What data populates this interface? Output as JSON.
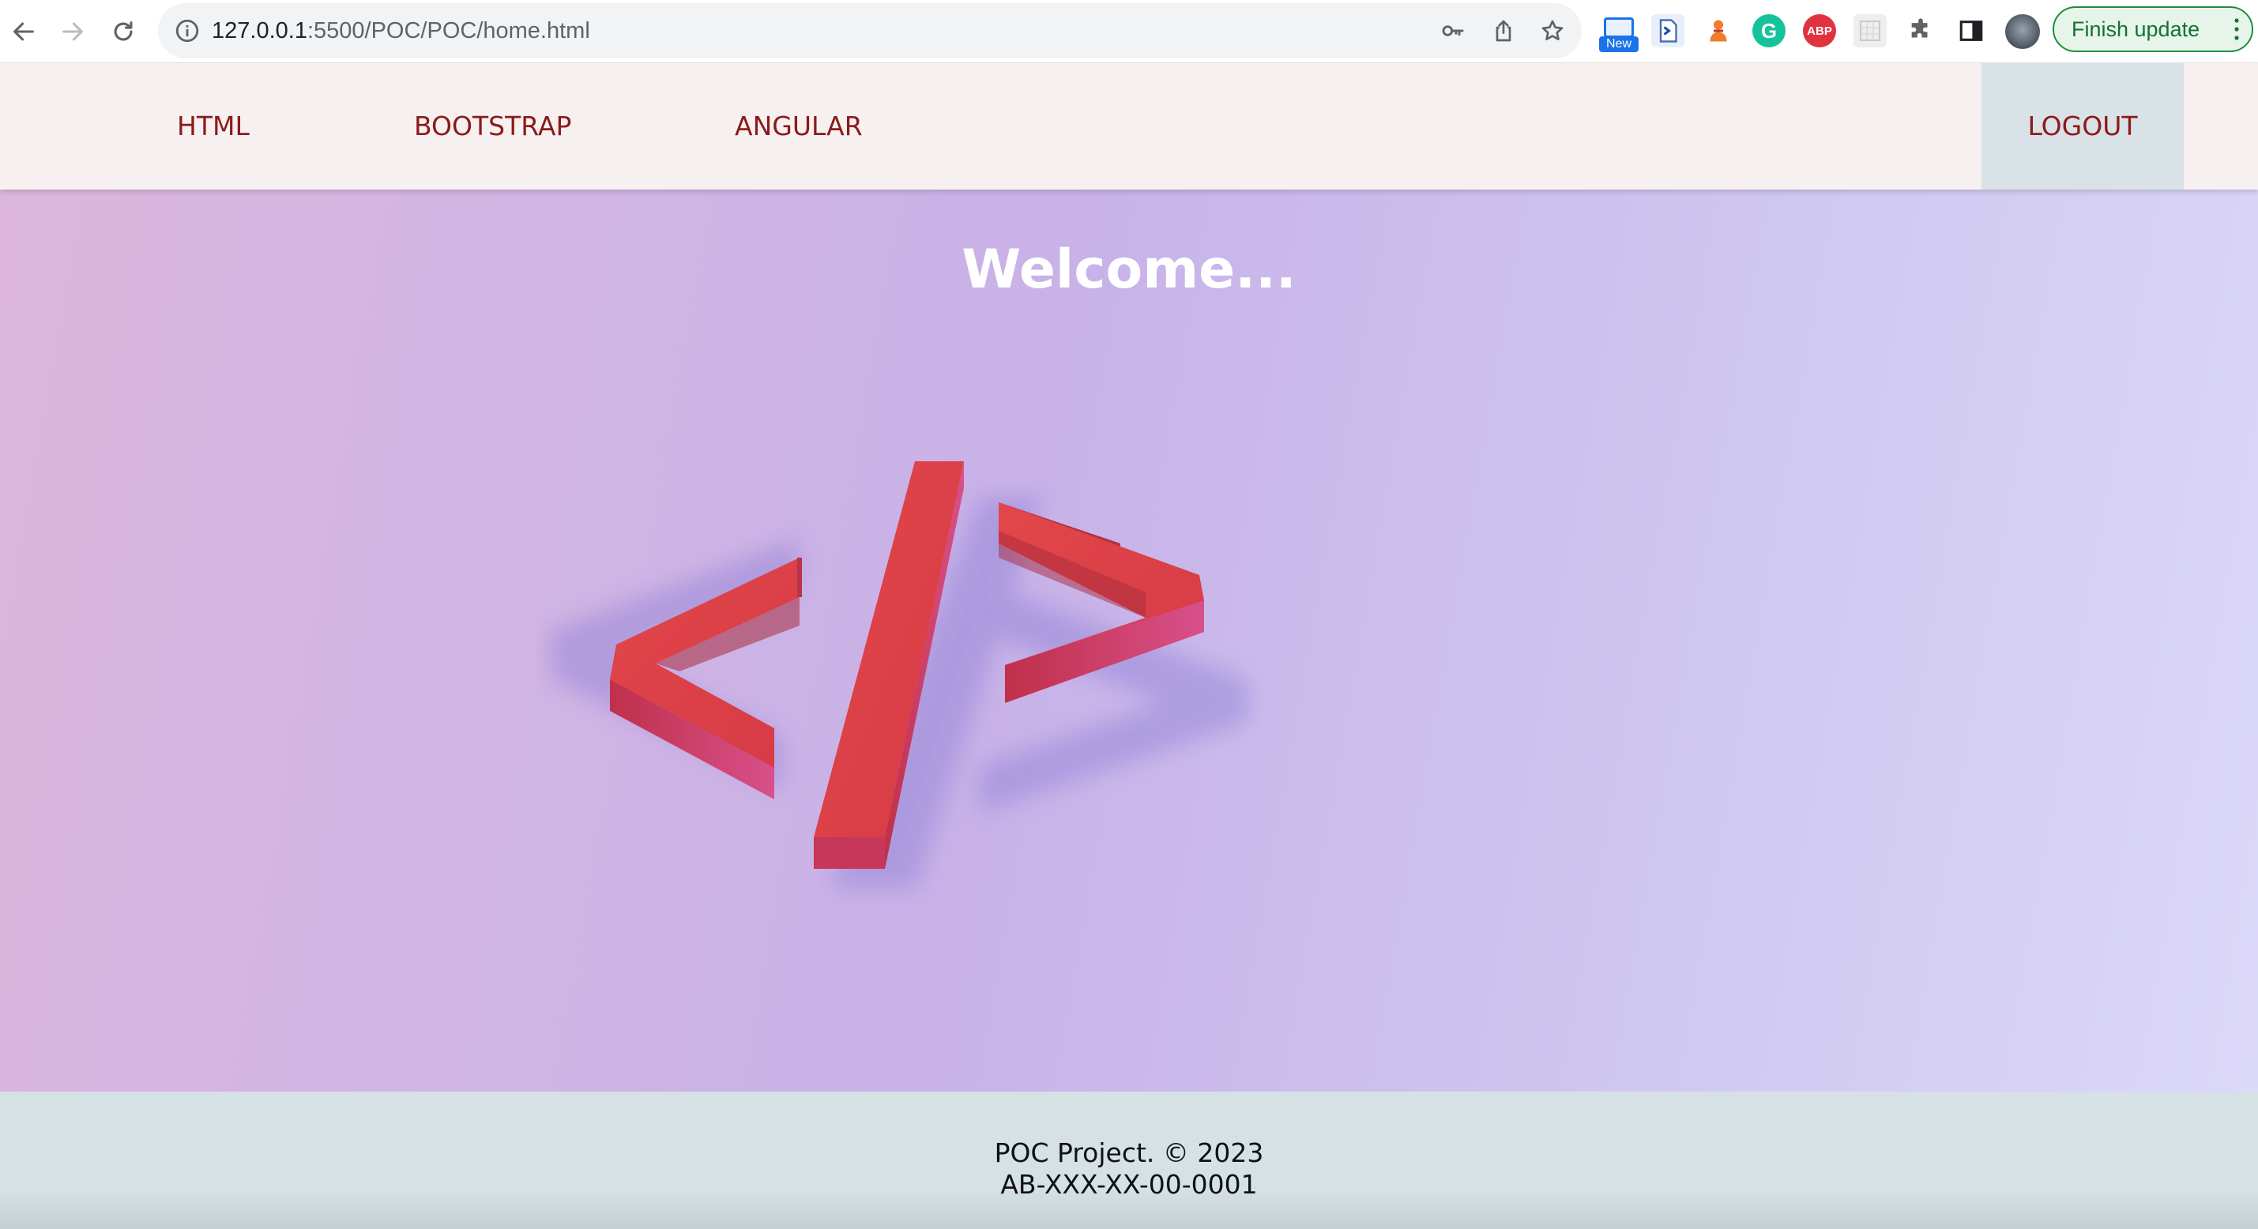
{
  "browser": {
    "url_host": "127.0.0.1",
    "url_rest": ":5500/POC/POC/home.html",
    "extension_new_badge": "New",
    "abp_label": "ABP",
    "grammarly_label": "G",
    "finish_update_label": "Finish update",
    "icons": {
      "back": "arrow-left-icon",
      "forward": "arrow-right-icon",
      "reload": "reload-icon",
      "info": "info-icon",
      "key": "key-icon",
      "share": "share-icon",
      "bookmark": "star-icon",
      "extensions": "puzzle-icon",
      "side_panel": "side-panel-icon"
    },
    "colors": {
      "grammarly": "#15c39a",
      "abp": "#e0323f",
      "finish_update": "#137333"
    }
  },
  "nav": {
    "links": [
      {
        "label": "HTML"
      },
      {
        "label": "BOOTSTRAP"
      },
      {
        "label": "ANGULAR"
      }
    ],
    "logout_label": "LOGOUT",
    "link_color": "#8b1a1a"
  },
  "hero": {
    "title": "Welcome...",
    "art_icon": "code-brackets-icon",
    "art_color": "#d9403f"
  },
  "footer": {
    "line1": "POC Project. © 2023",
    "line2": "AB-XXX-XX-00-0001"
  }
}
